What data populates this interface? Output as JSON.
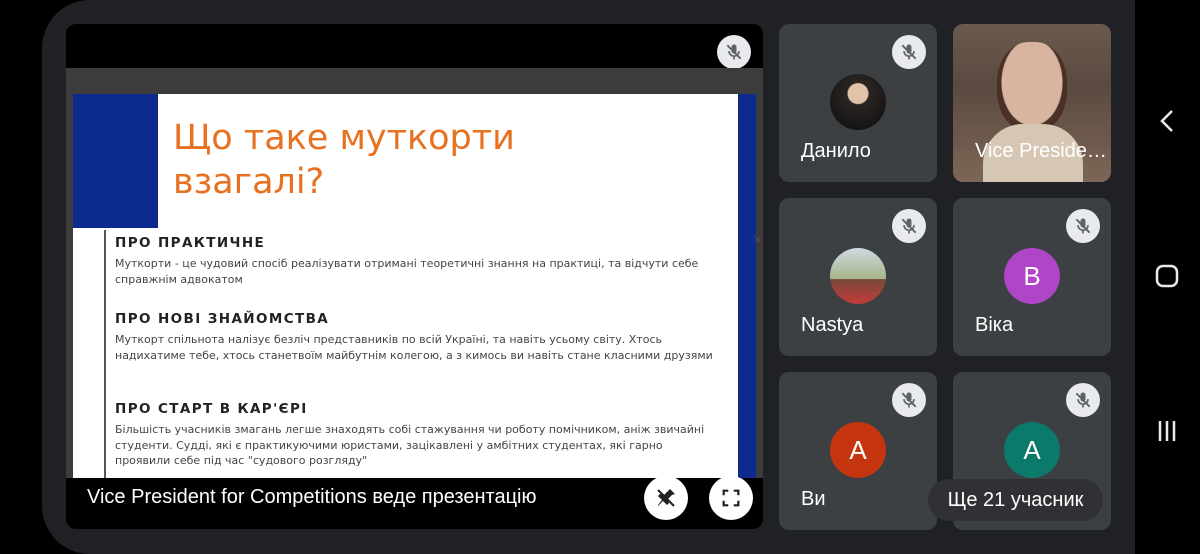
{
  "presentation": {
    "caption": "Vice President for Competitions веде презентацію",
    "slide": {
      "title": "Що таке муткорти взагалі?",
      "sections": [
        {
          "heading": "ПРО ПРАКТИЧНЕ",
          "text": "Муткорти - це чудовий спосіб реалізувати отримані теоретичні знання на практиці, та відчути себе справжнім адвокатом"
        },
        {
          "heading": "ПРО НОВІ ЗНАЙОМСТВА",
          "text": "Муткорт спільнота налізує безліч представників по всій Україні, та навіть усьому світу. Хтось надихатиме тебе, хтось станетвоїм майбутнім колегою, а з кимось ви навіть стане класними друзями"
        },
        {
          "heading": "ПРО СТАРТ В КАР'ЄРІ",
          "text": "Більшість учасників змагань легше знаходять собі стажування чи роботу помічником, аніж звичайні студенти. Судді, які є практикуючими юристами, зацікавлені у амбітних студентах, які гарно проявили себе під час \"судового розгляду\""
        }
      ]
    }
  },
  "participants": [
    {
      "name": "Данило",
      "avatar": "photo",
      "muted": true
    },
    {
      "name": "Vice Preside…",
      "avatar": "video",
      "muted": false
    },
    {
      "name": "Nastya",
      "avatar": "photo",
      "muted": true
    },
    {
      "name": "Віка",
      "avatar": "B",
      "avatar_color": "#b045c8",
      "muted": true
    },
    {
      "name": "Ви",
      "avatar": "A",
      "avatar_color": "#c5350f",
      "muted": true
    },
    {
      "name": "",
      "avatar": "A",
      "avatar_color": "#0b7a6a",
      "muted": true
    }
  ],
  "more_participants": "Ще 21 учасник",
  "icons": {
    "muted_mic": "mic-off-icon",
    "unpin": "unpin-icon",
    "fullscreen": "fullscreen-icon",
    "back": "back-icon",
    "home": "home-icon",
    "recents": "recents-icon"
  }
}
